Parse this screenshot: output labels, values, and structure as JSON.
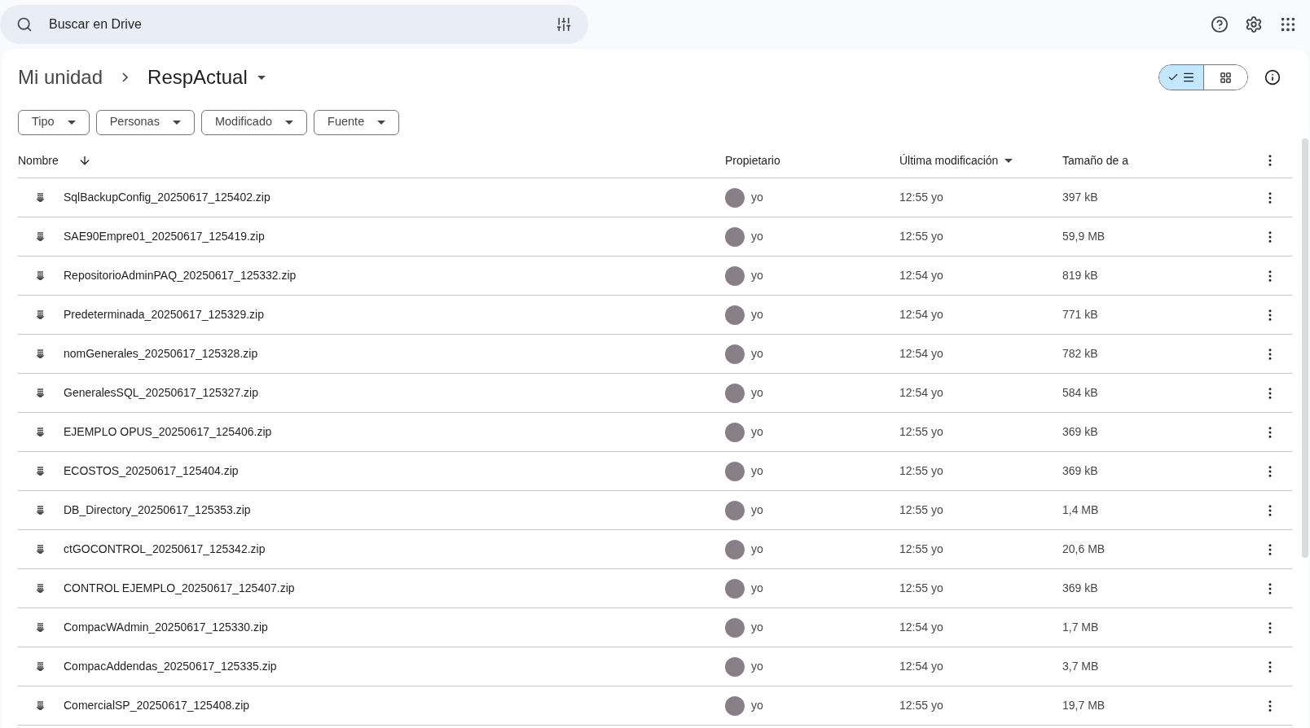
{
  "search": {
    "placeholder": "Buscar en Drive"
  },
  "breadcrumb": {
    "root": "Mi unidad",
    "current": "RespActual"
  },
  "view_toggle": [
    {
      "kind": "list",
      "selected": true
    },
    {
      "kind": "grid",
      "selected": false
    }
  ],
  "filters": [
    "Tipo",
    "Personas",
    "Modificado",
    "Fuente"
  ],
  "table": {
    "columns": [
      "Nombre",
      "Propietario",
      "Última modificación",
      "Tamaño de a"
    ],
    "rows": [
      {
        "name": "SqlBackupConfig_20250617_125402.zip",
        "owner": "yo",
        "modified": "12:55 yo",
        "size": "397 kB"
      },
      {
        "name": "SAE90Empre01_20250617_125419.zip",
        "owner": "yo",
        "modified": "12:55 yo",
        "size": "59,9 MB"
      },
      {
        "name": "RepositorioAdminPAQ_20250617_125332.zip",
        "owner": "yo",
        "modified": "12:54 yo",
        "size": "819 kB"
      },
      {
        "name": "Predeterminada_20250617_125329.zip",
        "owner": "yo",
        "modified": "12:54 yo",
        "size": "771 kB"
      },
      {
        "name": "nomGenerales_20250617_125328.zip",
        "owner": "yo",
        "modified": "12:54 yo",
        "size": "782 kB"
      },
      {
        "name": "GeneralesSQL_20250617_125327.zip",
        "owner": "yo",
        "modified": "12:54 yo",
        "size": "584 kB"
      },
      {
        "name": "EJEMPLO OPUS_20250617_125406.zip",
        "owner": "yo",
        "modified": "12:55 yo",
        "size": "369 kB"
      },
      {
        "name": "ECOSTOS_20250617_125404.zip",
        "owner": "yo",
        "modified": "12:55 yo",
        "size": "369 kB"
      },
      {
        "name": "DB_Directory_20250617_125353.zip",
        "owner": "yo",
        "modified": "12:55 yo",
        "size": "1,4 MB"
      },
      {
        "name": "ctGOCONTROL_20250617_125342.zip",
        "owner": "yo",
        "modified": "12:55 yo",
        "size": "20,6 MB"
      },
      {
        "name": "CONTROL EJEMPLO_20250617_125407.zip",
        "owner": "yo",
        "modified": "12:55 yo",
        "size": "369 kB"
      },
      {
        "name": "CompacWAdmin_20250617_125330.zip",
        "owner": "yo",
        "modified": "12:54 yo",
        "size": "1,7 MB"
      },
      {
        "name": "CompacAddendas_20250617_125335.zip",
        "owner": "yo",
        "modified": "12:54 yo",
        "size": "3,7 MB"
      },
      {
        "name": "ComercialSP_20250617_125408.zip",
        "owner": "yo",
        "modified": "12:55 yo",
        "size": "19,7 MB"
      }
    ]
  }
}
